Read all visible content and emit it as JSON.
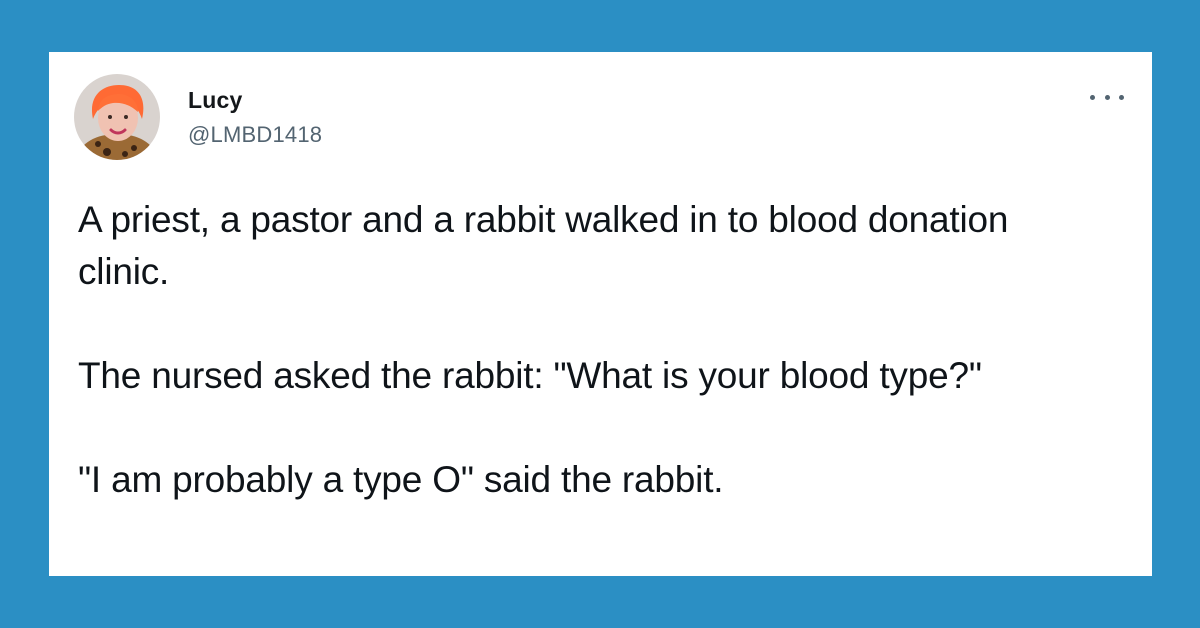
{
  "tweet": {
    "author_name": "Lucy",
    "author_handle": "@LMBD1418",
    "paragraphs": [
      "A priest, a pastor and a rabbit walked in to blood donation clinic.",
      "The nursed asked the rabbit: \"What is your blood type?\"",
      "\"I am probably a type O\" said the rabbit."
    ]
  },
  "icons": {
    "avatar": "avatar-photo",
    "more": "more-options-icon"
  },
  "colors": {
    "background": "#2b8fc4",
    "card": "#ffffff",
    "name": "#14171a",
    "handle": "#536471",
    "text": "#0f1419"
  }
}
